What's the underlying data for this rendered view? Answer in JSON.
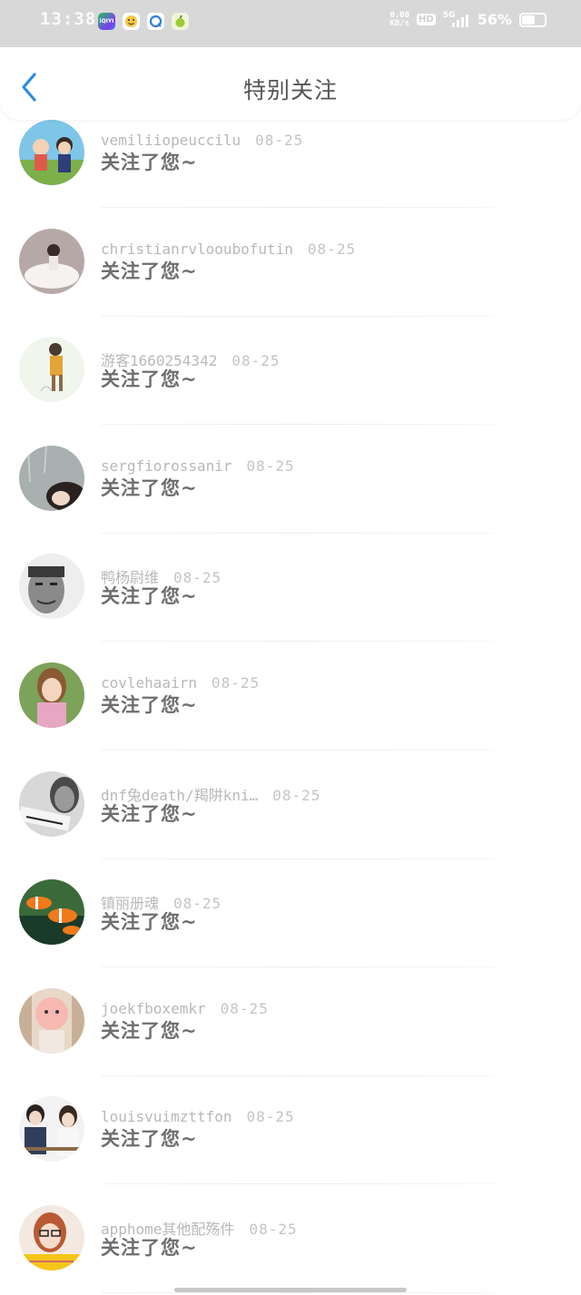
{
  "status_bar": {
    "time": "13:38",
    "net_speed_top": "0.00",
    "net_speed_bottom": "KB/s",
    "hd": "HD",
    "network": "5G",
    "battery": "56%"
  },
  "header": {
    "title": "特别关注",
    "back_icon": "chevron-left-icon",
    "accent": "#2b8de0"
  },
  "followers": [
    {
      "name": "vemiliiopeuccilu",
      "date": "08-25",
      "action": "关注了您~",
      "avatar": "anime-kids"
    },
    {
      "name": "christianrvlooubofutin",
      "date": "08-25",
      "action": "关注了您~",
      "avatar": "white-dress"
    },
    {
      "name": "游客1660254342",
      "date": "08-25",
      "action": "关注了您~",
      "avatar": "cartoon-girl"
    },
    {
      "name": "sergfiorossanir",
      "date": "08-25",
      "action": "关注了您~",
      "avatar": "window-girl"
    },
    {
      "name": "鸭杨尉维",
      "date": "08-25",
      "action": "关注了您~",
      "avatar": "bw-man"
    },
    {
      "name": "covlehaairn",
      "date": "08-25",
      "action": "关注了您~",
      "avatar": "smiling-woman"
    },
    {
      "name": "dnf兔death/羯阱kni…",
      "date": "08-25",
      "action": "关注了您~",
      "avatar": "bw-sign"
    },
    {
      "name": "镇丽册魂",
      "date": "08-25",
      "action": "关注了您~",
      "avatar": "clownfish"
    },
    {
      "name": "joekfboxemkr",
      "date": "08-25",
      "action": "关注了您~",
      "avatar": "baby-face"
    },
    {
      "name": "louisvuimzttfon",
      "date": "08-25",
      "action": "关注了您~",
      "avatar": "couple"
    },
    {
      "name": "apphome其他配殇件",
      "date": "08-25",
      "action": "关注了您~",
      "avatar": "glasses-girl"
    }
  ]
}
